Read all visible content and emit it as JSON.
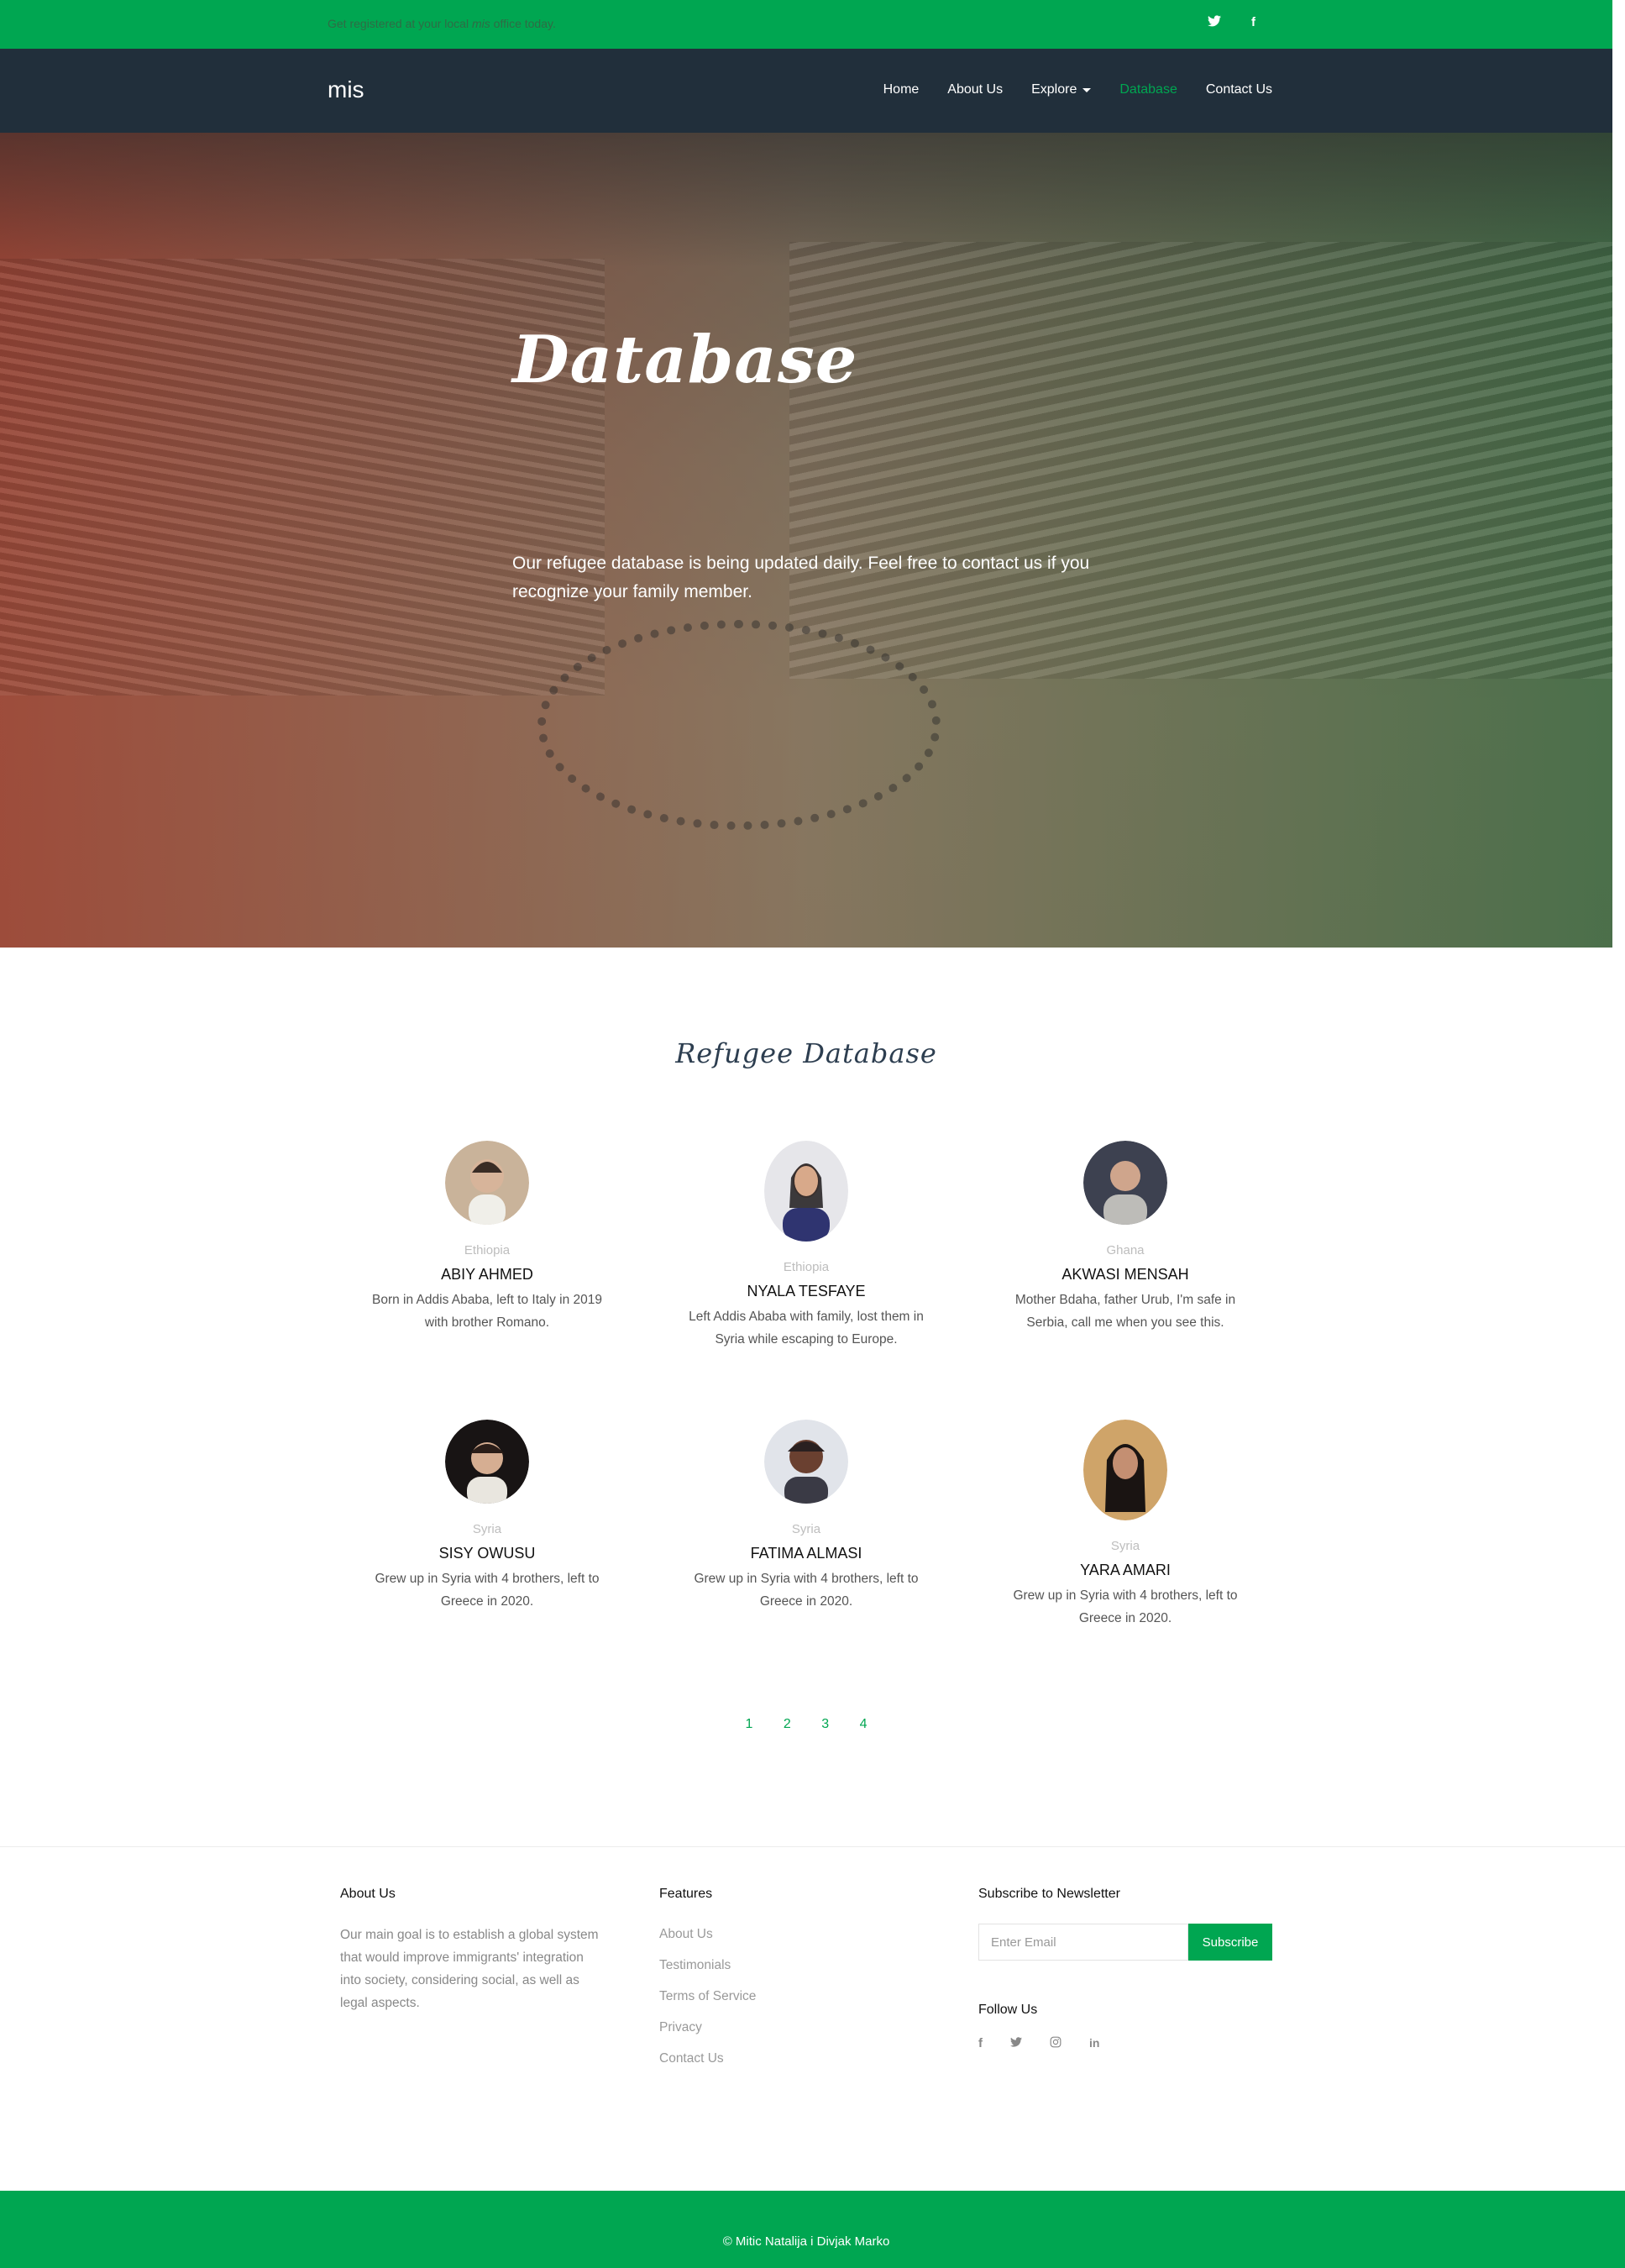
{
  "topbar": {
    "prefix": "Get registered at your local ",
    "brand": "mis",
    "suffix": " office today.",
    "twitter_glyph": "𝕥",
    "facebook_glyph": "f"
  },
  "navbar": {
    "logo": "mis",
    "items": [
      "Home",
      "About Us",
      "Explore",
      "Database",
      "Contact Us"
    ],
    "active": "Database"
  },
  "hero": {
    "title": "Database",
    "subtitle": "Our refugee database is being updated daily. Feel free to contact us if you recognize your family member."
  },
  "section": {
    "title": "Refugee Database"
  },
  "people": [
    {
      "country": "Ethiopia",
      "name": "ABIY AHMED",
      "desc": "Born in Addis Ababa, left to Italy in 2019 with brother Romano.",
      "avatar_color": "#c9b39a"
    },
    {
      "country": "Ethiopia",
      "name": "NYALA TESFAYE",
      "desc": "Left Addis Ababa with family, lost them in Syria while escaping to Europe.",
      "avatar_color": "#3b3f5c"
    },
    {
      "country": "Ghana",
      "name": "AKWASI MENSAH",
      "desc": "Mother Bdaha, father Urub, I'm safe in Serbia, call me when you see this.",
      "avatar_color": "#5a5d66"
    },
    {
      "country": "Syria",
      "name": "SISY OWUSU",
      "desc": "Grew up in Syria with 4 brothers, left to Greece in 2020.",
      "avatar_color": "#2a2624"
    },
    {
      "country": "Syria",
      "name": "FATIMA ALMASI",
      "desc": "Grew up in Syria with 4 brothers, left to Greece in 2020.",
      "avatar_color": "#6b4a3a"
    },
    {
      "country": "Syria",
      "name": "YARA AMARI",
      "desc": "Grew up in Syria with 4 brothers, left to Greece in 2020.",
      "avatar_color": "#c9a06a"
    }
  ],
  "pagination": [
    "1",
    "2",
    "3",
    "4"
  ],
  "footer": {
    "about": {
      "title": "About Us",
      "text": "Our main goal is to establish a global system that would improve immigrants' integration into society, considering social, as well as legal aspects."
    },
    "features": {
      "title": "Features",
      "links": [
        "About Us",
        "Testimonials",
        "Terms of Service",
        "Privacy",
        "Contact Us"
      ]
    },
    "newsletter": {
      "title": "Subscribe to Newsletter",
      "placeholder": "Enter Email",
      "button": "Subscribe"
    },
    "follow": {
      "title": "Follow Us",
      "icons": [
        "facebook-icon",
        "twitter-icon",
        "instagram-icon",
        "linkedin-icon"
      ]
    }
  },
  "copyright": "© Mitic Natalija i Divjak Marko",
  "colors": {
    "brand_green": "#00a651",
    "navbar_dark": "#212f3b"
  }
}
